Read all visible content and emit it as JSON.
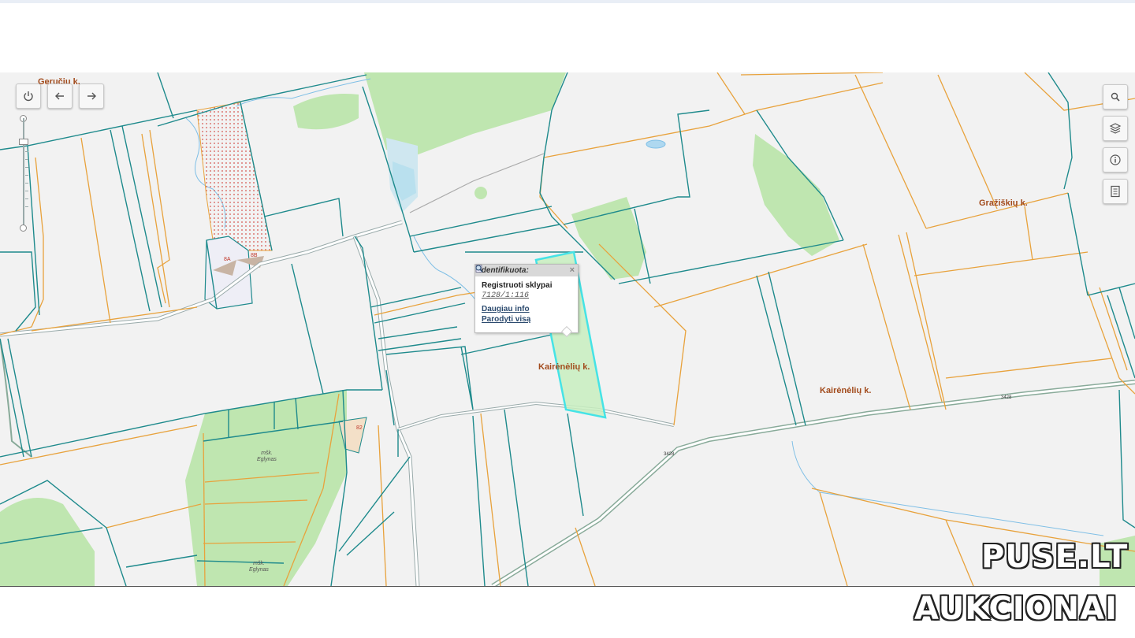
{
  "map": {
    "labels": {
      "village_top_left": "Geručių k.",
      "village_east": "Gražiškių k.",
      "village_center": "Kairėnėlių k.",
      "village_right": "Kairėnėlių k.",
      "house_8a": "8A",
      "house_8b": "8B",
      "house_82": "82",
      "forest_1": "mšk.\nEglynas",
      "forest_2": "mšk.\nEglynas",
      "road_3428_a": "3428",
      "road_3428_b": "3428"
    }
  },
  "popup": {
    "title": "Identifikuota:",
    "close": "×",
    "layer": "Registruoti sklypai",
    "parcel_id": "7128/1:116",
    "link_info": "Daugiau info",
    "link_show": "Parodyti visą"
  },
  "watermark": {
    "line1": "PUSE.LT",
    "line2": "AUKCIONAI"
  },
  "colors": {
    "parcel_border": "#1e8a8c",
    "cadastral_border": "#e8a23c",
    "forest": "#bfe6b0",
    "selected": "#45e3e6",
    "land": "#f2f2f2"
  },
  "toolbar": {
    "icons": [
      "power-icon",
      "arrow-left-icon",
      "arrow-right-icon",
      "search-icon",
      "layers-icon",
      "info-icon",
      "legend-icon"
    ]
  }
}
